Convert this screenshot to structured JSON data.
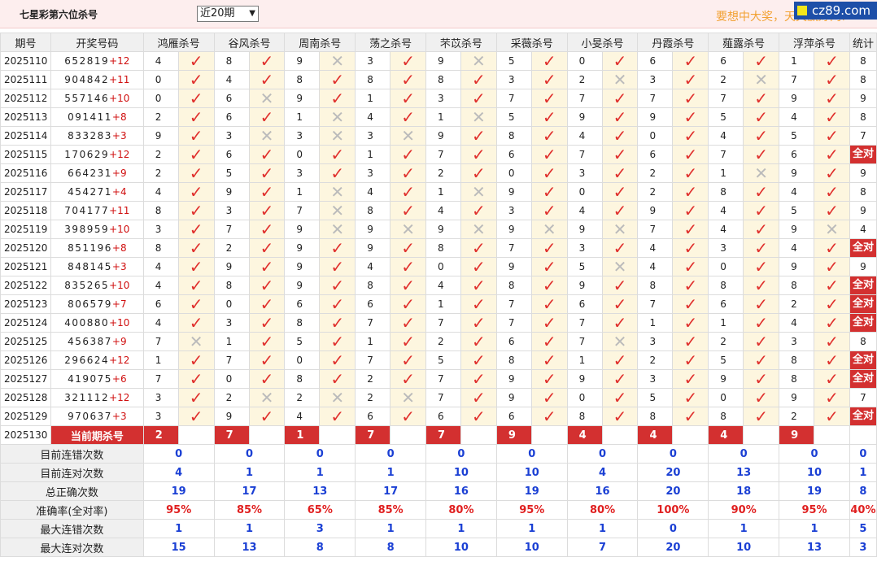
{
  "header": {
    "title": "七星彩第六位杀号",
    "period_select": "近20期",
    "slogan": "要想中大奖，天天赢好网!",
    "logo": "cz89.com"
  },
  "columns": [
    "期号",
    "开奖号码",
    "鸿雁杀号",
    "谷风杀号",
    "周南杀号",
    "荡之杀号",
    "芣苡杀号",
    "采薇杀号",
    "小旻杀号",
    "丹霞杀号",
    "薤露杀号",
    "浮萍杀号",
    "统计"
  ],
  "rows": [
    {
      "issue": "2025110",
      "digits": "652819",
      "sum": "+12",
      "kills": [
        [
          "4",
          1
        ],
        [
          "8",
          1
        ],
        [
          "9",
          0
        ],
        [
          "3",
          1
        ],
        [
          "9",
          0
        ],
        [
          "5",
          1
        ],
        [
          "0",
          1
        ],
        [
          "6",
          1
        ],
        [
          "6",
          1
        ],
        [
          "1",
          1
        ]
      ],
      "stat": "8"
    },
    {
      "issue": "2025111",
      "digits": "904842",
      "sum": "+11",
      "kills": [
        [
          "0",
          1
        ],
        [
          "4",
          1
        ],
        [
          "8",
          1
        ],
        [
          "8",
          1
        ],
        [
          "8",
          1
        ],
        [
          "3",
          1
        ],
        [
          "2",
          0
        ],
        [
          "3",
          1
        ],
        [
          "2",
          0
        ],
        [
          "7",
          1
        ]
      ],
      "stat": "8"
    },
    {
      "issue": "2025112",
      "digits": "557146",
      "sum": "+10",
      "kills": [
        [
          "0",
          1
        ],
        [
          "6",
          0
        ],
        [
          "9",
          1
        ],
        [
          "1",
          1
        ],
        [
          "3",
          1
        ],
        [
          "7",
          1
        ],
        [
          "7",
          1
        ],
        [
          "7",
          1
        ],
        [
          "7",
          1
        ],
        [
          "9",
          1
        ]
      ],
      "stat": "9"
    },
    {
      "issue": "2025113",
      "digits": "091411",
      "sum": "+8",
      "kills": [
        [
          "2",
          1
        ],
        [
          "6",
          1
        ],
        [
          "1",
          0
        ],
        [
          "4",
          1
        ],
        [
          "1",
          0
        ],
        [
          "5",
          1
        ],
        [
          "9",
          1
        ],
        [
          "9",
          1
        ],
        [
          "5",
          1
        ],
        [
          "4",
          1
        ]
      ],
      "stat": "8"
    },
    {
      "issue": "2025114",
      "digits": "833283",
      "sum": "+3",
      "kills": [
        [
          "9",
          1
        ],
        [
          "3",
          0
        ],
        [
          "3",
          0
        ],
        [
          "3",
          0
        ],
        [
          "9",
          1
        ],
        [
          "8",
          1
        ],
        [
          "4",
          1
        ],
        [
          "0",
          1
        ],
        [
          "4",
          1
        ],
        [
          "5",
          1
        ]
      ],
      "stat": "7"
    },
    {
      "issue": "2025115",
      "digits": "170629",
      "sum": "+12",
      "kills": [
        [
          "2",
          1
        ],
        [
          "6",
          1
        ],
        [
          "0",
          1
        ],
        [
          "1",
          1
        ],
        [
          "7",
          1
        ],
        [
          "6",
          1
        ],
        [
          "7",
          1
        ],
        [
          "6",
          1
        ],
        [
          "7",
          1
        ],
        [
          "6",
          1
        ]
      ],
      "stat": "全对"
    },
    {
      "issue": "2025116",
      "digits": "664231",
      "sum": "+9",
      "kills": [
        [
          "2",
          1
        ],
        [
          "5",
          1
        ],
        [
          "3",
          1
        ],
        [
          "3",
          1
        ],
        [
          "2",
          1
        ],
        [
          "0",
          1
        ],
        [
          "3",
          1
        ],
        [
          "2",
          1
        ],
        [
          "1",
          0
        ],
        [
          "9",
          1
        ]
      ],
      "stat": "9"
    },
    {
      "issue": "2025117",
      "digits": "454271",
      "sum": "+4",
      "kills": [
        [
          "4",
          1
        ],
        [
          "9",
          1
        ],
        [
          "1",
          0
        ],
        [
          "4",
          1
        ],
        [
          "1",
          0
        ],
        [
          "9",
          1
        ],
        [
          "0",
          1
        ],
        [
          "2",
          1
        ],
        [
          "8",
          1
        ],
        [
          "4",
          1
        ]
      ],
      "stat": "8"
    },
    {
      "issue": "2025118",
      "digits": "704177",
      "sum": "+11",
      "kills": [
        [
          "8",
          1
        ],
        [
          "3",
          1
        ],
        [
          "7",
          0
        ],
        [
          "8",
          1
        ],
        [
          "4",
          1
        ],
        [
          "3",
          1
        ],
        [
          "4",
          1
        ],
        [
          "9",
          1
        ],
        [
          "4",
          1
        ],
        [
          "5",
          1
        ]
      ],
      "stat": "9"
    },
    {
      "issue": "2025119",
      "digits": "398959",
      "sum": "+10",
      "kills": [
        [
          "3",
          1
        ],
        [
          "7",
          1
        ],
        [
          "9",
          0
        ],
        [
          "9",
          0
        ],
        [
          "9",
          0
        ],
        [
          "9",
          0
        ],
        [
          "9",
          0
        ],
        [
          "7",
          1
        ],
        [
          "4",
          1
        ],
        [
          "9",
          0
        ]
      ],
      "stat": "4"
    },
    {
      "issue": "2025120",
      "digits": "851196",
      "sum": "+8",
      "kills": [
        [
          "8",
          1
        ],
        [
          "2",
          1
        ],
        [
          "9",
          1
        ],
        [
          "9",
          1
        ],
        [
          "8",
          1
        ],
        [
          "7",
          1
        ],
        [
          "3",
          1
        ],
        [
          "4",
          1
        ],
        [
          "3",
          1
        ],
        [
          "4",
          1
        ]
      ],
      "stat": "全对"
    },
    {
      "issue": "2025121",
      "digits": "848145",
      "sum": "+3",
      "kills": [
        [
          "4",
          1
        ],
        [
          "9",
          1
        ],
        [
          "9",
          1
        ],
        [
          "4",
          1
        ],
        [
          "0",
          1
        ],
        [
          "9",
          1
        ],
        [
          "5",
          0
        ],
        [
          "4",
          1
        ],
        [
          "0",
          1
        ],
        [
          "9",
          1
        ]
      ],
      "stat": "9"
    },
    {
      "issue": "2025122",
      "digits": "835265",
      "sum": "+10",
      "kills": [
        [
          "4",
          1
        ],
        [
          "8",
          1
        ],
        [
          "9",
          1
        ],
        [
          "8",
          1
        ],
        [
          "4",
          1
        ],
        [
          "8",
          1
        ],
        [
          "9",
          1
        ],
        [
          "8",
          1
        ],
        [
          "8",
          1
        ],
        [
          "8",
          1
        ]
      ],
      "stat": "全对"
    },
    {
      "issue": "2025123",
      "digits": "806579",
      "sum": "+7",
      "kills": [
        [
          "6",
          1
        ],
        [
          "0",
          1
        ],
        [
          "6",
          1
        ],
        [
          "6",
          1
        ],
        [
          "1",
          1
        ],
        [
          "7",
          1
        ],
        [
          "6",
          1
        ],
        [
          "7",
          1
        ],
        [
          "6",
          1
        ],
        [
          "2",
          1
        ]
      ],
      "stat": "全对"
    },
    {
      "issue": "2025124",
      "digits": "400880",
      "sum": "+10",
      "kills": [
        [
          "4",
          1
        ],
        [
          "3",
          1
        ],
        [
          "8",
          1
        ],
        [
          "7",
          1
        ],
        [
          "7",
          1
        ],
        [
          "7",
          1
        ],
        [
          "7",
          1
        ],
        [
          "1",
          1
        ],
        [
          "1",
          1
        ],
        [
          "4",
          1
        ]
      ],
      "stat": "全对"
    },
    {
      "issue": "2025125",
      "digits": "456387",
      "sum": "+9",
      "kills": [
        [
          "7",
          0
        ],
        [
          "1",
          1
        ],
        [
          "5",
          1
        ],
        [
          "1",
          1
        ],
        [
          "2",
          1
        ],
        [
          "6",
          1
        ],
        [
          "7",
          0
        ],
        [
          "3",
          1
        ],
        [
          "2",
          1
        ],
        [
          "3",
          1
        ]
      ],
      "stat": "8"
    },
    {
      "issue": "2025126",
      "digits": "296624",
      "sum": "+12",
      "kills": [
        [
          "1",
          1
        ],
        [
          "7",
          1
        ],
        [
          "0",
          1
        ],
        [
          "7",
          1
        ],
        [
          "5",
          1
        ],
        [
          "8",
          1
        ],
        [
          "1",
          1
        ],
        [
          "2",
          1
        ],
        [
          "5",
          1
        ],
        [
          "8",
          1
        ]
      ],
      "stat": "全对"
    },
    {
      "issue": "2025127",
      "digits": "419075",
      "sum": "+6",
      "kills": [
        [
          "7",
          1
        ],
        [
          "0",
          1
        ],
        [
          "8",
          1
        ],
        [
          "2",
          1
        ],
        [
          "7",
          1
        ],
        [
          "9",
          1
        ],
        [
          "9",
          1
        ],
        [
          "3",
          1
        ],
        [
          "9",
          1
        ],
        [
          "8",
          1
        ]
      ],
      "stat": "全对"
    },
    {
      "issue": "2025128",
      "digits": "321112",
      "sum": "+12",
      "kills": [
        [
          "3",
          1
        ],
        [
          "2",
          0
        ],
        [
          "2",
          0
        ],
        [
          "2",
          0
        ],
        [
          "7",
          1
        ],
        [
          "9",
          1
        ],
        [
          "0",
          1
        ],
        [
          "5",
          1
        ],
        [
          "0",
          1
        ],
        [
          "9",
          1
        ]
      ],
      "stat": "7"
    },
    {
      "issue": "2025129",
      "digits": "970637",
      "sum": "+3",
      "kills": [
        [
          "3",
          1
        ],
        [
          "9",
          1
        ],
        [
          "4",
          1
        ],
        [
          "6",
          1
        ],
        [
          "6",
          1
        ],
        [
          "6",
          1
        ],
        [
          "8",
          1
        ],
        [
          "8",
          1
        ],
        [
          "8",
          1
        ],
        [
          "2",
          1
        ]
      ],
      "stat": "全对"
    }
  ],
  "current": {
    "issue": "2025130",
    "label": "当前期杀号",
    "values": [
      "2",
      "7",
      "1",
      "7",
      "7",
      "9",
      "4",
      "4",
      "4",
      "9"
    ]
  },
  "stats": [
    {
      "label": "目前连错次数",
      "values": [
        "0",
        "0",
        "0",
        "0",
        "0",
        "0",
        "0",
        "0",
        "0",
        "0",
        "0"
      ],
      "pct": false
    },
    {
      "label": "目前连对次数",
      "values": [
        "4",
        "1",
        "1",
        "1",
        "10",
        "10",
        "4",
        "20",
        "13",
        "10",
        "1"
      ],
      "pct": false
    },
    {
      "label": "总正确次数",
      "values": [
        "19",
        "17",
        "13",
        "17",
        "16",
        "19",
        "16",
        "20",
        "18",
        "19",
        "8"
      ],
      "pct": false
    },
    {
      "label": "准确率(全对率)",
      "values": [
        "95%",
        "85%",
        "65%",
        "85%",
        "80%",
        "95%",
        "80%",
        "100%",
        "90%",
        "95%",
        "40%"
      ],
      "pct": true
    },
    {
      "label": "最大连错次数",
      "values": [
        "1",
        "1",
        "3",
        "1",
        "1",
        "1",
        "1",
        "0",
        "1",
        "1",
        "5"
      ],
      "pct": false
    },
    {
      "label": "最大连对次数",
      "values": [
        "15",
        "13",
        "8",
        "8",
        "10",
        "10",
        "7",
        "20",
        "10",
        "13",
        "3"
      ],
      "pct": false
    }
  ],
  "colors": {
    "check": "#e0302d",
    "cross": "#bbbbbb",
    "highlight": "#d33030",
    "blue": "#1a3fd4"
  }
}
